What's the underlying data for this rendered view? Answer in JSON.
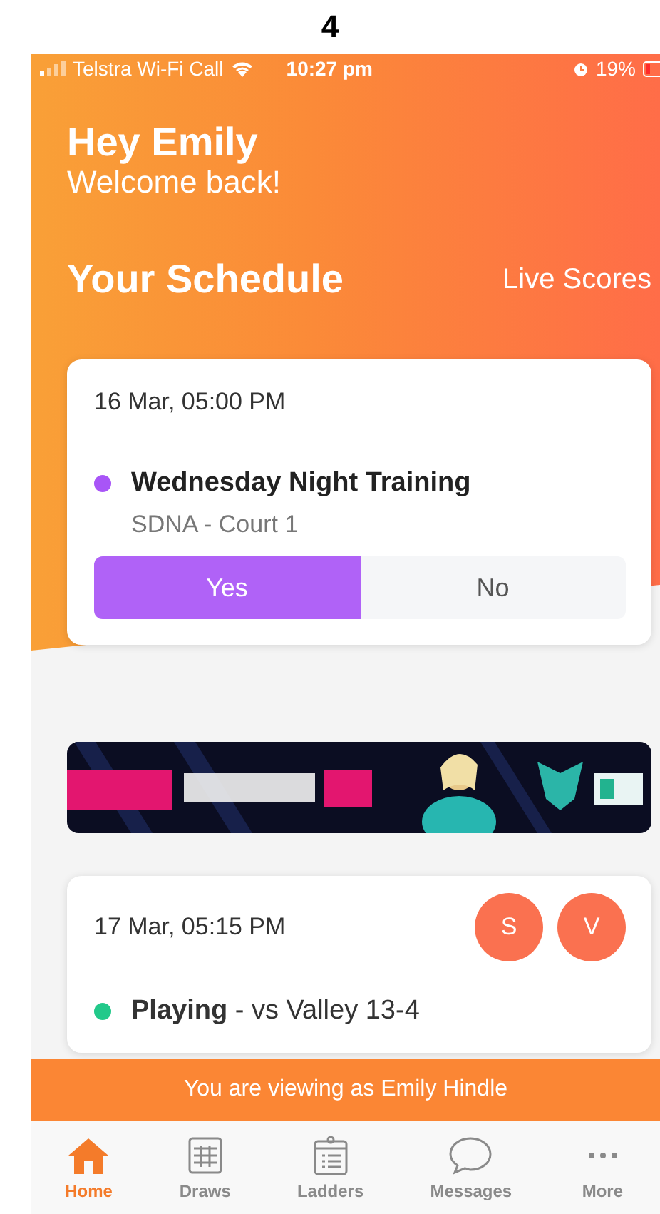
{
  "page_label": "4",
  "status_bar": {
    "carrier": "Telstra Wi-Fi Call",
    "time": "10:27 pm",
    "battery": "19%"
  },
  "greeting": {
    "title": "Hey Emily",
    "subtitle": "Welcome back!"
  },
  "schedule": {
    "title": "Your Schedule",
    "link": "Live Scores"
  },
  "feed": [
    {
      "kind": "rsvp",
      "date": "16 Mar, 05:00 PM",
      "color": "#a855f7",
      "title": "Wednesday Night Training",
      "location": "SDNA - Court 1",
      "options": [
        {
          "label": "Yes",
          "selected": true
        },
        {
          "label": "No",
          "selected": false
        }
      ]
    },
    {
      "kind": "picture"
    },
    {
      "kind": "match",
      "date": "17 Mar, 05:15 PM",
      "avatars": [
        "S",
        "V"
      ],
      "color": "#22c98a",
      "text": "**Playing** - vs Valley 13-4"
    }
  ],
  "viewing_bar": "You are viewing as Emily Hindle",
  "nav": [
    {
      "label": "Home",
      "kind": "home",
      "selected": true
    },
    {
      "label": "Draws",
      "kind": "grid",
      "selected": false
    },
    {
      "label": "Ladders",
      "kind": "clipboard",
      "selected": false
    },
    {
      "label": "Messages",
      "kind": "bubble",
      "selected": false
    },
    {
      "label": "More",
      "kind": "dots",
      "selected": false
    }
  ]
}
